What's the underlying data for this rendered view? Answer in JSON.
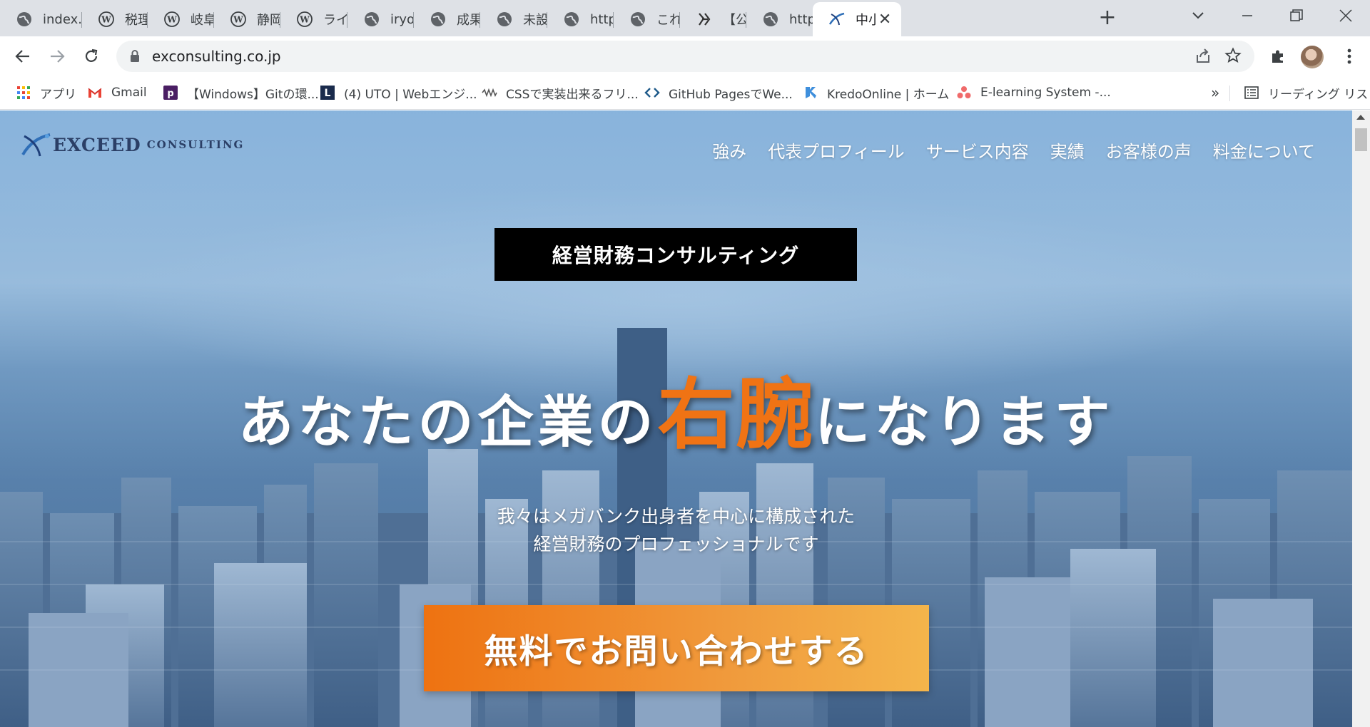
{
  "browser": {
    "tabs": [
      {
        "title": "index.h",
        "favicon": "globe-icon"
      },
      {
        "title": "税理士",
        "favicon": "wordpress-icon"
      },
      {
        "title": "岐阜の",
        "favicon": "wordpress-icon"
      },
      {
        "title": "静岡助",
        "favicon": "wordpress-icon"
      },
      {
        "title": "ライブセ",
        "favicon": "wordpress-icon"
      },
      {
        "title": "iryohou",
        "favicon": "globe-icon"
      },
      {
        "title": "成果を",
        "favicon": "globe-icon"
      },
      {
        "title": "未設定",
        "favicon": "globe-icon"
      },
      {
        "title": "https:/",
        "favicon": "globe-icon"
      },
      {
        "title": "これから",
        "favicon": "globe-icon"
      },
      {
        "title": "【公式】",
        "favicon": "brand-icon"
      },
      {
        "title": "https:/",
        "favicon": "globe-icon"
      },
      {
        "title": "中小",
        "favicon": "exceed-logo-icon",
        "active": true
      }
    ],
    "url": "exconsulting.co.jp",
    "bookmarks": [
      {
        "label": "アプリ",
        "icon": "apps-grid-icon"
      },
      {
        "label": "Gmail",
        "icon": "gmail-icon"
      },
      {
        "label": "【Windows】Gitの環...",
        "icon": "p-icon"
      },
      {
        "label": "(4) UTO | Webエンジ...",
        "icon": "l-icon"
      },
      {
        "label": "CSSで実装出来るフリ...",
        "icon": "wave-icon"
      },
      {
        "label": "GitHub PagesでWe...",
        "icon": "code-icon"
      },
      {
        "label": "KredoOnline | ホーム",
        "icon": "kredo-icon"
      },
      {
        "label": "E-learning System -...",
        "icon": "asana-icon"
      }
    ],
    "bookmarks_overflow": "»",
    "reading_list": "リーディング リスト"
  },
  "site": {
    "logo_main": "EXCEED",
    "logo_sub": "CONSULTING",
    "nav": [
      "強み",
      "代表プロフィール",
      "サービス内容",
      "実績",
      "お客様の声",
      "料金について"
    ],
    "eyebrow": "経営財務コンサルティング",
    "headline_before": "あなたの企業の",
    "headline_accent": "右腕",
    "headline_after": "になります",
    "subcopy_line1": "我々はメガバンク出身者を中心に構成された",
    "subcopy_line2": "経営財務のプロフェッショナルです",
    "cta": "無料でお問い合わせする"
  },
  "colors": {
    "accent_orange": "#f07314",
    "cta_start": "#ee7211",
    "cta_end": "#f4b54b",
    "logo_navy": "#2b3f66"
  }
}
